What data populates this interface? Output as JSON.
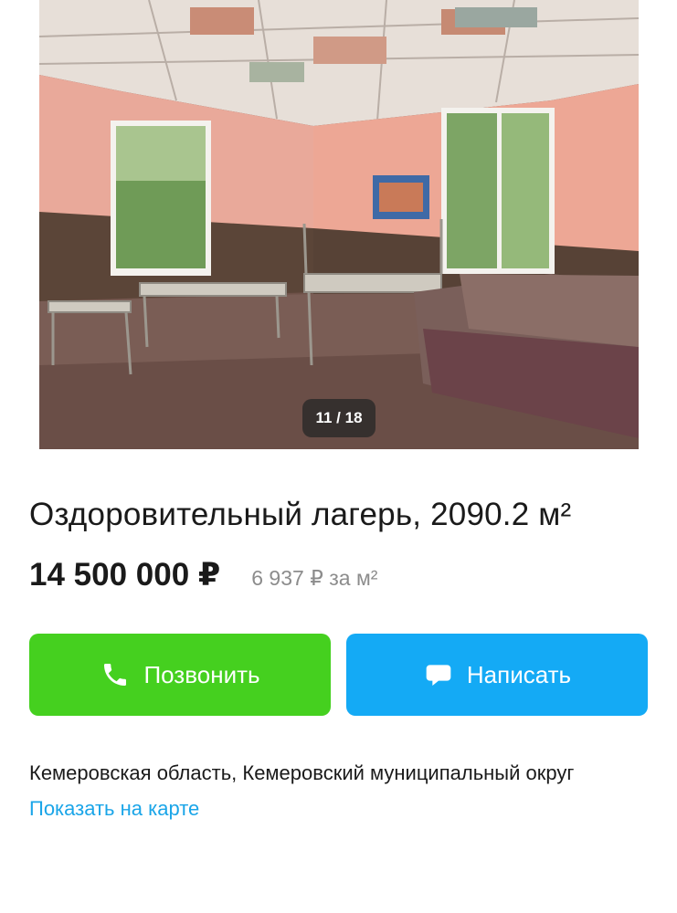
{
  "gallery": {
    "counter": "11 / 18"
  },
  "listing": {
    "title": "Оздоровительный лагерь, 2090.2 м²",
    "price": "14 500 000 ₽",
    "price_per_m2": "6 937 ₽ за м²"
  },
  "actions": {
    "call_label": "Позвонить",
    "write_label": "Написать",
    "call_color": "#45d01f",
    "write_color": "#14aaf5"
  },
  "location": {
    "address": "Кемеровская область, Кемеровский муниципальный округ",
    "map_link": "Показать на карте"
  },
  "icons": {
    "call": "phone-icon",
    "write": "chat-bubble-icon"
  }
}
